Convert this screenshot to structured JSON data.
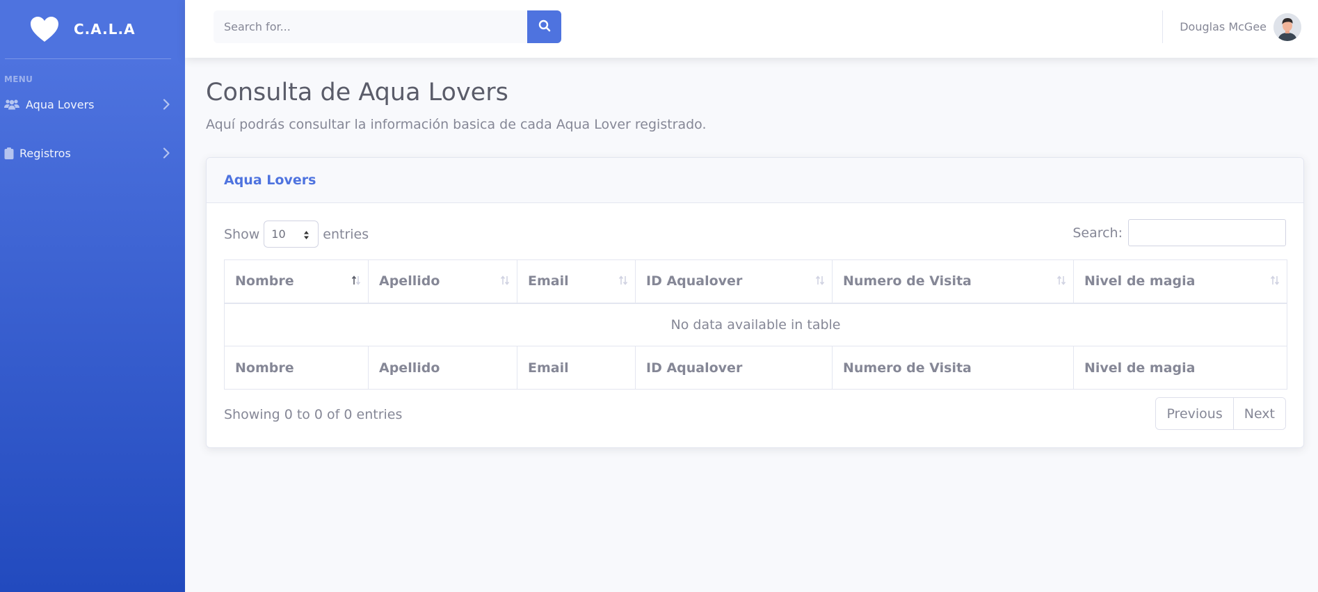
{
  "brand": {
    "name": "C.A.L.A"
  },
  "sidebar": {
    "heading": "MENU",
    "items": [
      {
        "label": "Aqua Lovers",
        "icon": "users-icon"
      },
      {
        "label": "Registros",
        "icon": "clipboard-icon"
      }
    ]
  },
  "topbar": {
    "search_placeholder": "Search for...",
    "user_name": "Douglas McGee"
  },
  "page": {
    "title": "Consulta de Aqua Lovers",
    "subtitle": "Aquí podrás consultar la información basica de cada Aqua Lover registrado."
  },
  "card": {
    "title": "Aqua Lovers",
    "length_label_before": "Show",
    "length_value": "10",
    "length_label_after": "entries",
    "search_label": "Search:",
    "columns": [
      "Nombre",
      "Apellido",
      "Email",
      "ID Aqualover",
      "Numero de Visita",
      "Nivel de magia"
    ],
    "empty_message": "No data available in table",
    "info": "Showing 0 to 0 of 0 entries",
    "paging": {
      "previous": "Previous",
      "next": "Next"
    }
  },
  "colors": {
    "primary": "#4e73df",
    "sidebar_end": "#224abe",
    "text_muted": "#858796"
  }
}
